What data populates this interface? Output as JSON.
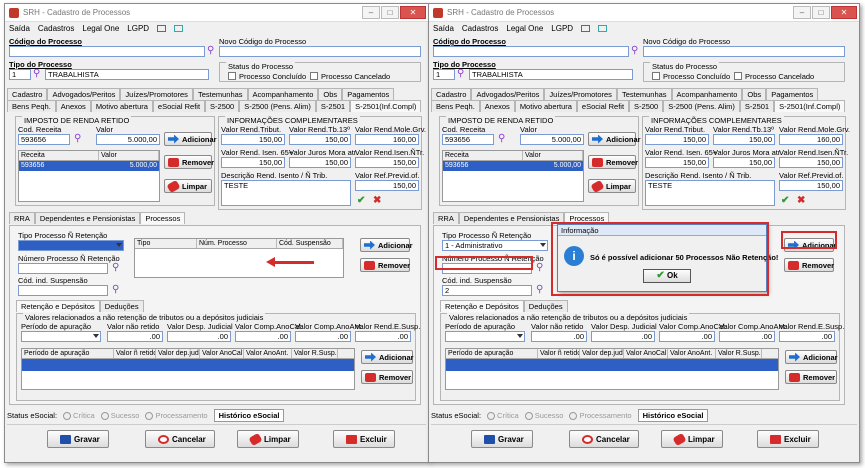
{
  "window": {
    "title": "SRH - Cadastro de Processos"
  },
  "menu": [
    "Saída",
    "Cadastros",
    "Legal One",
    "LGPD"
  ],
  "processo": {
    "codigo_label": "Código do Processo",
    "novo_codigo_label": "Novo Código do Processo",
    "tipo_label": "Tipo do Processo",
    "tipo_code": "1",
    "tipo_desc": "TRABALHISTA",
    "status_title": "Status do Processo",
    "concluido": "Processo Concluído",
    "cancelado": "Processo Cancelado"
  },
  "tabs_row1": [
    "Cadastro",
    "Advogados/Peritos",
    "Juízes/Promotores",
    "Testemunhas",
    "Acompanhamento",
    "Obs",
    "Pagamentos"
  ],
  "tabs_row2": [
    "Bens Peqh.",
    "Anexos",
    "Motivo abertura",
    "eSocial Refit",
    "S-2500",
    "S-2500 (Pens. Alim)",
    "S-2501",
    "S-2501(Inf.Compl)"
  ],
  "imposto": {
    "title": "IMPOSTO DE RENDA RETIDO",
    "cod_receita_label": "Cod. Receita",
    "valor_label": "Valor",
    "cod_receita": "593656",
    "valor": "5.000,00",
    "grid_headers": [
      "Receita",
      "Valor"
    ],
    "grid_row": [
      "593656",
      "5.000,00"
    ],
    "btn_add": "Adicionar",
    "btn_remove": "Remover",
    "btn_clear": "Limpar"
  },
  "info": {
    "title": "INFORMAÇÕES COMPLEMENTARES",
    "labels": [
      "Valor Rend.Tribut.",
      "Valor Rend.Tb.13º",
      "Valor Rend.Mole.Grv.",
      "Valor Rend. Isen. 65+",
      "Valor Juros Mora atr.",
      "Valor Rend.Isen.ÑTr.",
      "Descrição Rend. Isento / Ñ Trib.",
      "Valor Ref.Previd.of."
    ],
    "values": [
      "150,00",
      "150,00",
      "160,00",
      "150,00",
      "150,00",
      "150,00",
      "150,00"
    ],
    "descricao": "TESTE"
  },
  "subtabs": [
    "RRA",
    "Dependentes e Pensionistas",
    "Processos"
  ],
  "processos": {
    "tipo_label": "Tipo Processo Ñ Retenção",
    "numero_label": "Número Processo Ñ Retenção",
    "cod_susp_label": "Cód. ind. Suspensão",
    "tipo_value_w2": "1 - Administrativo",
    "cod_susp_w2": "2",
    "grid_headers": [
      "Tipo",
      "Núm. Processo",
      "Cód. Suspensão"
    ],
    "btn_add": "Adicionar",
    "btn_remove": "Remover"
  },
  "ret_tabs": [
    "Retenção e Depósitos",
    "Deduções"
  ],
  "valores": {
    "title": "Valores relacionados a não retenção de tributos ou a depósitos judiciais",
    "labels": [
      "Período de apuração",
      "Valor não retido",
      "Valor Desp. Judicial",
      "Valor Comp.AnoCal.",
      "Valor Comp.AnoAnt.",
      "Valor Rend.E.Susp."
    ],
    "values": [
      ".00",
      ".00",
      ".00",
      ".00",
      ".00"
    ],
    "grid_headers": [
      "Período de apuração",
      "Valor ñ retido",
      "Valor dep.jud.",
      "Valor AnoCal.",
      "Valor AnoAnt.",
      "Valor R.Susp."
    ],
    "btn_add": "Adicionar",
    "btn_remove": "Remover"
  },
  "status_bar": {
    "label": "Status eSocial:",
    "items": [
      "Crítica",
      "Sucesso",
      "Processamento"
    ],
    "historico": "Histórico eSocial"
  },
  "footer": {
    "gravar": "Gravar",
    "cancelar": "Cancelar",
    "limpar": "Limpar",
    "excluir": "Excluir"
  },
  "dialog": {
    "title": "Informação",
    "message": "Só é possível adicionar 50 Processos Não Retenção!",
    "ok": "Ok"
  },
  "colors": {
    "accent": "#2d5fc4",
    "alert": "#d62b2b"
  }
}
